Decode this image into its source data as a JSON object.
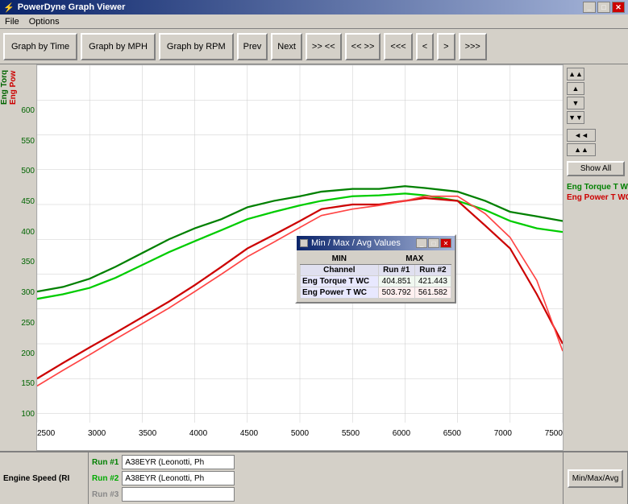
{
  "window": {
    "title": "PowerDyne Graph Viewer",
    "title_icon": "⚡"
  },
  "menu": {
    "items": [
      "File",
      "Options"
    ]
  },
  "toolbar": {
    "buttons": [
      {
        "id": "graph-by-time",
        "label": "Graph by Time"
      },
      {
        "id": "graph-by-mph",
        "label": "Graph by MPH"
      },
      {
        "id": "graph-by-rpm",
        "label": "Graph by RPM"
      },
      {
        "id": "prev",
        "label": "Prev"
      },
      {
        "id": "next",
        "label": "Next"
      },
      {
        "id": "fast-forward",
        "label": ">> <<"
      },
      {
        "id": "rewind",
        "label": "<< >>"
      },
      {
        "id": "skip-back",
        "label": "<<<"
      },
      {
        "id": "back",
        "label": "<"
      },
      {
        "id": "forward",
        "label": ">"
      },
      {
        "id": "skip-forward",
        "label": ">>>"
      }
    ]
  },
  "chart": {
    "y_axis_left_label": "Eng Torq",
    "y_axis_right_label": "Eng Pow",
    "y_ticks": [
      "600",
      "550",
      "500",
      "450",
      "400",
      "350",
      "300",
      "250",
      "200",
      "150",
      "100"
    ],
    "x_ticks": [
      "2500",
      "3000",
      "3500",
      "4000",
      "4500",
      "5000",
      "5500",
      "6000",
      "6500",
      "7000",
      "7500"
    ],
    "lines": [
      {
        "id": "eng-torque-run1",
        "color": "#008000",
        "label": "Eng Torque T WC"
      },
      {
        "id": "eng-power-run1",
        "color": "#cc0000",
        "label": "Eng Power T WC"
      },
      {
        "id": "eng-torque-run2",
        "color": "#00aa00",
        "label": ""
      },
      {
        "id": "eng-power-run2",
        "color": "#ff4444",
        "label": ""
      }
    ]
  },
  "sidebar": {
    "scroll_buttons": [
      {
        "label": "▲▲",
        "id": "scroll-top"
      },
      {
        "label": "▼▼",
        "id": "scroll-down-fast"
      },
      {
        "label": "▲",
        "id": "scroll-up"
      },
      {
        "label": "▼",
        "id": "scroll-down"
      },
      {
        "label": "◄◄",
        "id": "scroll-left-fast"
      },
      {
        "label": "▲▲",
        "id": "scroll-right-fast"
      }
    ],
    "show_all": "Show All",
    "legend": [
      {
        "color": "#008000",
        "text": "Eng Torque T WC"
      },
      {
        "color": "#cc0000",
        "text": "Eng Power T WC"
      }
    ]
  },
  "dialog": {
    "title": "Min / Max / Avg Values",
    "headers": [
      "",
      "MIN",
      "MAX"
    ],
    "subheaders": [
      "Channel",
      "Run #1",
      "Run #2"
    ],
    "rows": [
      {
        "channel": "Eng Torque T WC",
        "min": "404.851",
        "max": "421.443"
      },
      {
        "channel": "Eng Power T WC",
        "min": "503.792",
        "max": "561.582"
      }
    ]
  },
  "bottom": {
    "engine_speed_label": "Engine Speed (RI",
    "run1_label": "Run #1",
    "run1_color": "#008000",
    "run1_value": "A38EYR (Leonotti, Ph",
    "run2_label": "Run #2",
    "run2_color": "#00aa00",
    "run2_value": "A38EYR (Leonotti, Ph",
    "run3_label": "Run #3",
    "run3_color": "#cccccc",
    "run3_value": "",
    "min_max_avg_label": "Min/Max/Avg"
  }
}
